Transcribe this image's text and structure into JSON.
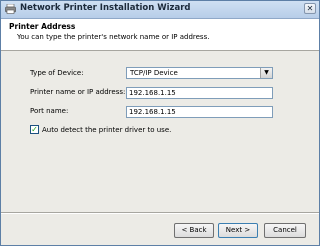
{
  "window": {
    "title": "Network Printer Installation Wizard",
    "close_glyph": "✕"
  },
  "header": {
    "title": "Printer Address",
    "subtitle": "You can type the printer's network name or IP address."
  },
  "form": {
    "device_type_label": "Type of Device:",
    "device_type_value": "TCP/IP Device",
    "host_label": "Printer name or IP address:",
    "host_value": "192.168.1.15",
    "port_label": "Port name:",
    "port_value": "192.168.1.15",
    "auto_detect_label": "Auto detect the printer driver to use.",
    "auto_detect_checked": true
  },
  "buttons": {
    "back": "< Back",
    "next": "Next >",
    "cancel": "Cancel"
  },
  "icons": {
    "title": "printer-icon",
    "close": "close-icon",
    "dropdown": "chevron-down-icon",
    "checkbox": "checkmark-icon"
  }
}
